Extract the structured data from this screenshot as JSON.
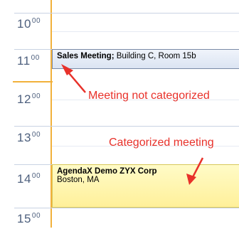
{
  "calendar": {
    "hours": [
      {
        "hour": "10",
        "minutes": "00"
      },
      {
        "hour": "11",
        "minutes": "00"
      },
      {
        "hour": "12",
        "minutes": "00"
      },
      {
        "hour": "13",
        "minutes": "00"
      },
      {
        "hour": "14",
        "minutes": "00"
      },
      {
        "hour": "15",
        "minutes": "00"
      }
    ],
    "appointments": [
      {
        "title": "Sales Meeting;",
        "location": "Building C, Room 15b",
        "categorized": false,
        "color": "#dbe4f2"
      },
      {
        "title": "AgendaX Demo ZYX Corp",
        "location": "Boston, MA",
        "categorized": true,
        "color": "#fff09a"
      }
    ]
  },
  "annotations": {
    "not_categorized": "Meeting not categorized",
    "categorized": "Categorized meeting",
    "color": "#e8312a"
  },
  "accent_color": "#f2b13b"
}
